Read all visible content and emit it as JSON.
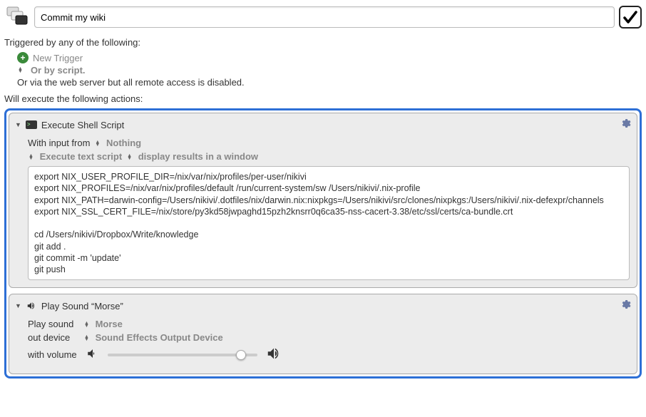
{
  "header": {
    "title": "Commit my wiki"
  },
  "triggers": {
    "section_label": "Triggered by any of the following:",
    "new_trigger": "New Trigger",
    "or_script": "Or by script.",
    "web_disabled": "Or via the web server but all remote access is disabled."
  },
  "actions_label": "Will execute the following actions:",
  "shell_action": {
    "title": "Execute Shell Script",
    "with_input_label": "With input from",
    "with_input_value": "Nothing",
    "exec_mode": "Execute text script",
    "display_mode": "display results in a window",
    "script": "export NIX_USER_PROFILE_DIR=/nix/var/nix/profiles/per-user/nikivi\nexport NIX_PROFILES=/nix/var/nix/profiles/default /run/current-system/sw /Users/nikivi/.nix-profile\nexport NIX_PATH=darwin-config=/Users/nikivi/.dotfiles/nix/darwin.nix:nixpkgs=/Users/nikivi/src/clones/nixpkgs:/Users/nikivi/.nix-defexpr/channels\nexport NIX_SSL_CERT_FILE=/nix/store/py3kd58jwpaghd15pzh2knsrr0q6ca35-nss-cacert-3.38/etc/ssl/certs/ca-bundle.crt\n\ncd /Users/nikivi/Dropbox/Write/knowledge\ngit add .\ngit commit -m 'update'\ngit push"
  },
  "sound_action": {
    "title": "Play Sound “Morse”",
    "play_label": "Play sound",
    "sound_name": "Morse",
    "device_label": "out device",
    "device_value": "Sound Effects Output Device",
    "volume_label": "with volume"
  }
}
